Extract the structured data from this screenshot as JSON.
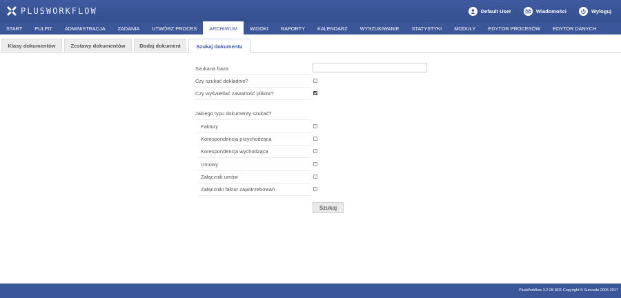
{
  "header": {
    "logo_text": "PLUSWORKFLOW",
    "user_links": [
      {
        "icon": "user-icon",
        "label": "Default User"
      },
      {
        "icon": "mail-icon",
        "label": "Wiadomości"
      },
      {
        "icon": "power-icon",
        "label": "Wyloguj"
      }
    ]
  },
  "menu": {
    "items": [
      "START",
      "PULPIT",
      "ADMINISTRACJA",
      "ZADANIA",
      "UTWÓRZ PROCES",
      "ARCHIWUM",
      "WIDOKI",
      "RAPORTY",
      "KALENDARZ",
      "WYSZUKIWANIE",
      "STATYSTYKI",
      "MODUŁY",
      "EDYTOR PROCESÓW",
      "EDYTOR DANYCH"
    ],
    "active": "ARCHIWUM"
  },
  "subtabs": {
    "items": [
      "Klasy dokumentów",
      "Zestawy dokumentów",
      "Dodaj dokument",
      "Szukaj dokumentu"
    ],
    "active": "Szukaj dokumentu"
  },
  "form": {
    "phrase_label": "Szukana fraza",
    "phrase_value": "",
    "exact_label": "Czy szukać dokładnie?",
    "exact_checked": false,
    "show_content_label": "Czy wyświetlać zawartość plików?",
    "show_content_checked": true,
    "types_heading": "Jakiego typu dokumenty szukać?",
    "types": [
      {
        "label": "Faktury",
        "checked": false
      },
      {
        "label": "Korespondencja przychodząca",
        "checked": false
      },
      {
        "label": "Korespondencja wychodząca",
        "checked": false
      },
      {
        "label": "Umowy",
        "checked": false
      },
      {
        "label": "Załącznik umów",
        "checked": false
      },
      {
        "label": "Załączniki faktur zapotrzebowań",
        "checked": false
      }
    ],
    "search_button": "Szukaj"
  },
  "footer": {
    "text": "PlusWorkflow 3.2.28.SR1 Copyright © Suncode 2006-2017"
  },
  "colors": {
    "header_bg": "#3b5699",
    "active_text": "#3b5699"
  }
}
